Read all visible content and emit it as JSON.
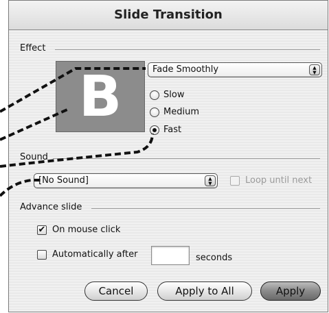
{
  "window": {
    "title": "Slide Transition"
  },
  "effect": {
    "section_label": "Effect",
    "preview_letter": "B",
    "popup_value": "Fade Smoothly",
    "speed_options": [
      {
        "label": "Slow",
        "checked": false
      },
      {
        "label": "Medium",
        "checked": false
      },
      {
        "label": "Fast",
        "checked": true
      }
    ]
  },
  "sound": {
    "section_label": "Sound",
    "popup_value": "[No Sound]",
    "loop_label": "Loop until next",
    "loop_checked": false,
    "loop_enabled": false
  },
  "advance": {
    "section_label": "Advance slide",
    "on_click_label": "On mouse click",
    "on_click_checked": true,
    "auto_label": "Automatically after",
    "auto_checked": false,
    "seconds_value": "",
    "unit_label": "seconds"
  },
  "buttons": {
    "cancel": "Cancel",
    "apply_all": "Apply to All",
    "apply": "Apply"
  },
  "glyphs": {
    "updown_arrows": "▲▼",
    "check": "✔"
  }
}
